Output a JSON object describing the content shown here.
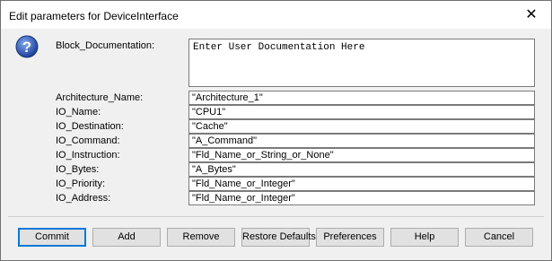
{
  "dialog": {
    "title": "Edit parameters for DeviceInterface",
    "close_glyph": "✕",
    "help_icon": "question-mark-icon"
  },
  "params": {
    "block_documentation": {
      "label": "Block_Documentation:",
      "value": "Enter User Documentation Here"
    },
    "architecture_name": {
      "label": "Architecture_Name:",
      "value": "\"Architecture_1\""
    },
    "io_name": {
      "label": "IO_Name:",
      "value": "\"CPU1\""
    },
    "io_destination": {
      "label": "IO_Destination:",
      "value": "\"Cache\""
    },
    "io_command": {
      "label": "IO_Command:",
      "value": "\"A_Command\""
    },
    "io_instruction": {
      "label": "IO_Instruction:",
      "value": "\"Fld_Name_or_String_or_None\""
    },
    "io_bytes": {
      "label": "IO_Bytes:",
      "value": "\"A_Bytes\""
    },
    "io_priority": {
      "label": "IO_Priority:",
      "value": "\"Fld_Name_or_Integer\""
    },
    "io_address": {
      "label": "IO_Address:",
      "value": "\"Fld_Name_or_Integer\""
    }
  },
  "buttons": {
    "commit": "Commit",
    "add": "Add",
    "remove": "Remove",
    "restore_defaults": "Restore Defaults",
    "preferences": "Preferences",
    "help": "Help",
    "cancel": "Cancel"
  },
  "colors": {
    "help_icon_fill": "#2a5ab8",
    "default_button_border": "#0078d7"
  }
}
